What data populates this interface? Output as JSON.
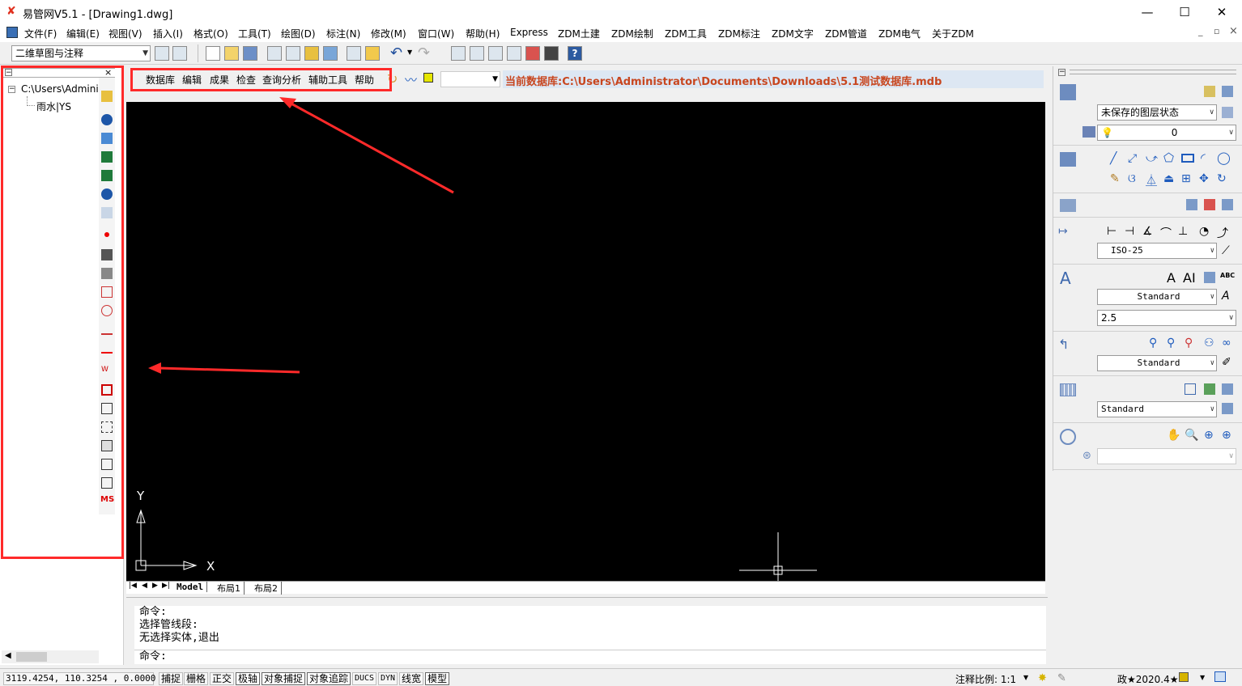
{
  "title": {
    "text": "易管网V5.1 - [Drawing1.dwg]",
    "min": "—",
    "max": "☐",
    "close": "✕"
  },
  "menu": [
    "文件(F)",
    "编辑(E)",
    "视图(V)",
    "插入(I)",
    "格式(O)",
    "工具(T)",
    "绘图(D)",
    "标注(N)",
    "修改(M)",
    "窗口(W)",
    "帮助(H)",
    "Express",
    "ZDM土建",
    "ZDM绘制",
    "ZDM工具",
    "ZDM标注",
    "ZDM文字",
    "ZDM管道",
    "ZDM电气",
    "关于ZDM"
  ],
  "mdi": {
    "min": "_",
    "restore": "▫",
    "close": "×"
  },
  "workspace": "二维草图与注释",
  "plugin_menu": [
    "数据库",
    "编辑",
    "成果",
    "检查",
    "查询分析",
    "辅助工具",
    "帮助"
  ],
  "current_db": "当前数据库:C:\\Users\\Administrator\\Documents\\Downloads\\5.1测试数据库.mdb",
  "tree": {
    "root": "C:\\Users\\Admini:",
    "child": "雨水|YS"
  },
  "tabs": [
    "Model",
    "布局1",
    "布局2"
  ],
  "command_lines": [
    "命令:",
    "选择管线段:",
    "无选择实体,退出"
  ],
  "command_prompt": "命令:",
  "coords": "3119.4254, 110.3254 , 0.0000",
  "status_toggles": [
    "捕捉",
    "栅格",
    "正交",
    "极轴",
    "对象捕捉",
    "对象追踪",
    "DUCS",
    "DYN",
    "线宽",
    "模型"
  ],
  "annotation_scale": "注释比例: 1:1",
  "status_right": "政★2020.4★",
  "right": {
    "layer_state": "未保存的图层状态",
    "layer": "0",
    "dimstyle": "ISO-25",
    "textstyle": "Standard",
    "textheight": "2.5",
    "mleaderstyle": "Standard",
    "tablestyle": "Standard"
  },
  "axis": {
    "x": "X",
    "y": "Y"
  },
  "colors": {
    "accent_red": "#ff2a2a",
    "db_text": "#c8461f",
    "canvas": "#000000"
  }
}
